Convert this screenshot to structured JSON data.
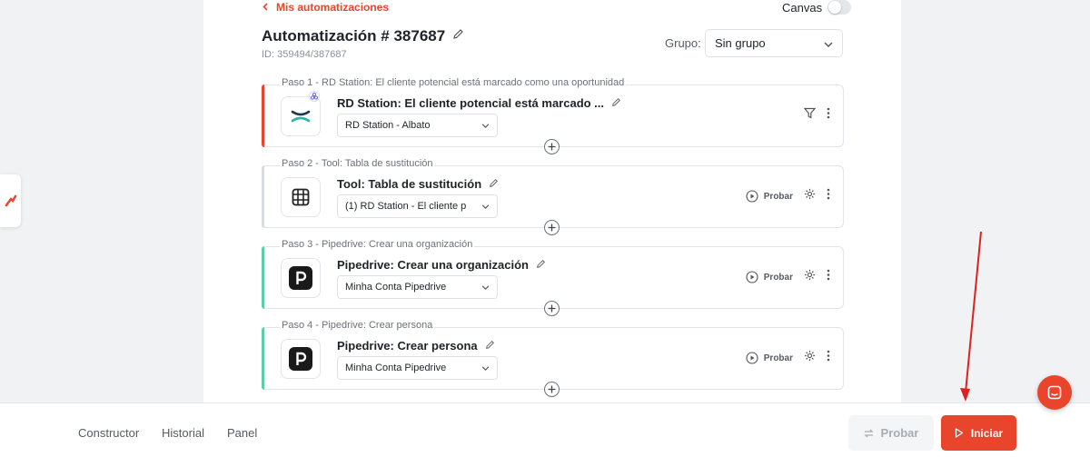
{
  "header": {
    "back_label": "Mis automatizaciones",
    "canvas_label": "Canvas",
    "title": "Automatización # 387687",
    "id_text": "ID: 359494/387687",
    "group_label": "Grupo:",
    "group_value": "Sin grupo"
  },
  "steps": [
    {
      "label": "Paso 1 - RD Station: El cliente potencial está marcado como una oportunidad",
      "name": "RD Station: El cliente potencial está marcado ...",
      "account": "RD Station - Albato",
      "accent": "#e8452c"
    },
    {
      "label": "Paso 2 - Tool: Tabla de sustitución",
      "name": "Tool: Tabla de sustitución",
      "account": "(1) RD Station - El cliente p",
      "probar": "Probar",
      "accent": "#d8dbe0"
    },
    {
      "label": "Paso 3 - Pipedrive: Crear una organización",
      "name": "Pipedrive: Crear una organización",
      "account": "Minha Conta Pipedrive",
      "probar": "Probar",
      "accent": "#5ccfa6"
    },
    {
      "label": "Paso 4 - Pipedrive: Crear persona",
      "name": "Pipedrive: Crear persona",
      "account": "Minha Conta Pipedrive",
      "probar": "Probar",
      "accent": "#5ccfa6"
    }
  ],
  "bottom": {
    "nav": [
      "Constructor",
      "Historial",
      "Panel"
    ],
    "probar_label": "Probar",
    "iniciar_label": "Iniciar"
  },
  "colors": {
    "accent": "#e8452c",
    "annotation_arrow": "#e02020"
  }
}
